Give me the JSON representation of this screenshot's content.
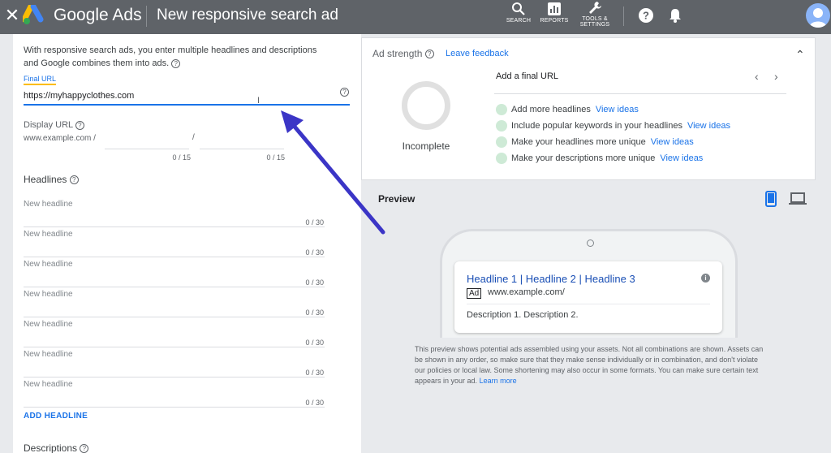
{
  "header": {
    "brand": "Google Ads",
    "title": "New responsive search ad",
    "tools": [
      {
        "label": "SEARCH",
        "icon": "search-icon"
      },
      {
        "label": "REPORTS",
        "icon": "reports-icon"
      },
      {
        "label": "TOOLS &\nSETTINGS",
        "icon": "wrench-icon"
      }
    ]
  },
  "form": {
    "intro": "With responsive search ads, you enter multiple headlines and descriptions and Google combines them into ads.",
    "final_url_label": "Final URL",
    "final_url_value": "https://myhappyclothes.com",
    "display_url_label": "Display URL",
    "display_url_base": "www.example.com /",
    "path_slash": "/",
    "path1_counter": "0 / 15",
    "path2_counter": "0 / 15",
    "headlines_label": "Headlines",
    "headline_placeholder": "New headline",
    "headline_counter": "0 / 30",
    "headlines": [
      {
        "placeholder": "New headline",
        "counter": "0 / 30"
      },
      {
        "placeholder": "New headline",
        "counter": "0 / 30"
      },
      {
        "placeholder": "New headline",
        "counter": "0 / 30"
      },
      {
        "placeholder": "New headline",
        "counter": "0 / 30"
      },
      {
        "placeholder": "New headline",
        "counter": "0 / 30"
      },
      {
        "placeholder": "New headline",
        "counter": "0 / 30"
      },
      {
        "placeholder": "New headline",
        "counter": "0 / 30"
      }
    ],
    "add_headline": "ADD HEADLINE",
    "descriptions_label": "Descriptions"
  },
  "ad_strength": {
    "title": "Ad strength",
    "feedback": "Leave feedback",
    "status": "Incomplete",
    "prompt": "Add a final URL",
    "suggestions": [
      {
        "text": "Add more headlines",
        "link": "View ideas"
      },
      {
        "text": "Include popular keywords in your headlines",
        "link": "View ideas"
      },
      {
        "text": "Make your headlines more unique",
        "link": "View ideas"
      },
      {
        "text": "Make your descriptions more unique",
        "link": "View ideas"
      }
    ]
  },
  "preview": {
    "title": "Preview",
    "ad_headline": "Headline 1 | Headline 2 | Headline 3",
    "ad_badge": "Ad",
    "ad_url": "www.example.com/",
    "ad_description": "Description 1. Description 2.",
    "disclaimer": "This preview shows potential ads assembled using your assets. Not all combinations are shown. Assets can be shown in any order, so make sure that they make sense individually or in combination, and don't violate our policies or local law. Some shortening may also occur in some formats. You can make sure certain text appears in your ad.",
    "learn_more": "Learn more"
  },
  "colors": {
    "topbar": "#5f6368",
    "accent": "#1a73e8",
    "annotation_arrow": "#3b35c6"
  }
}
